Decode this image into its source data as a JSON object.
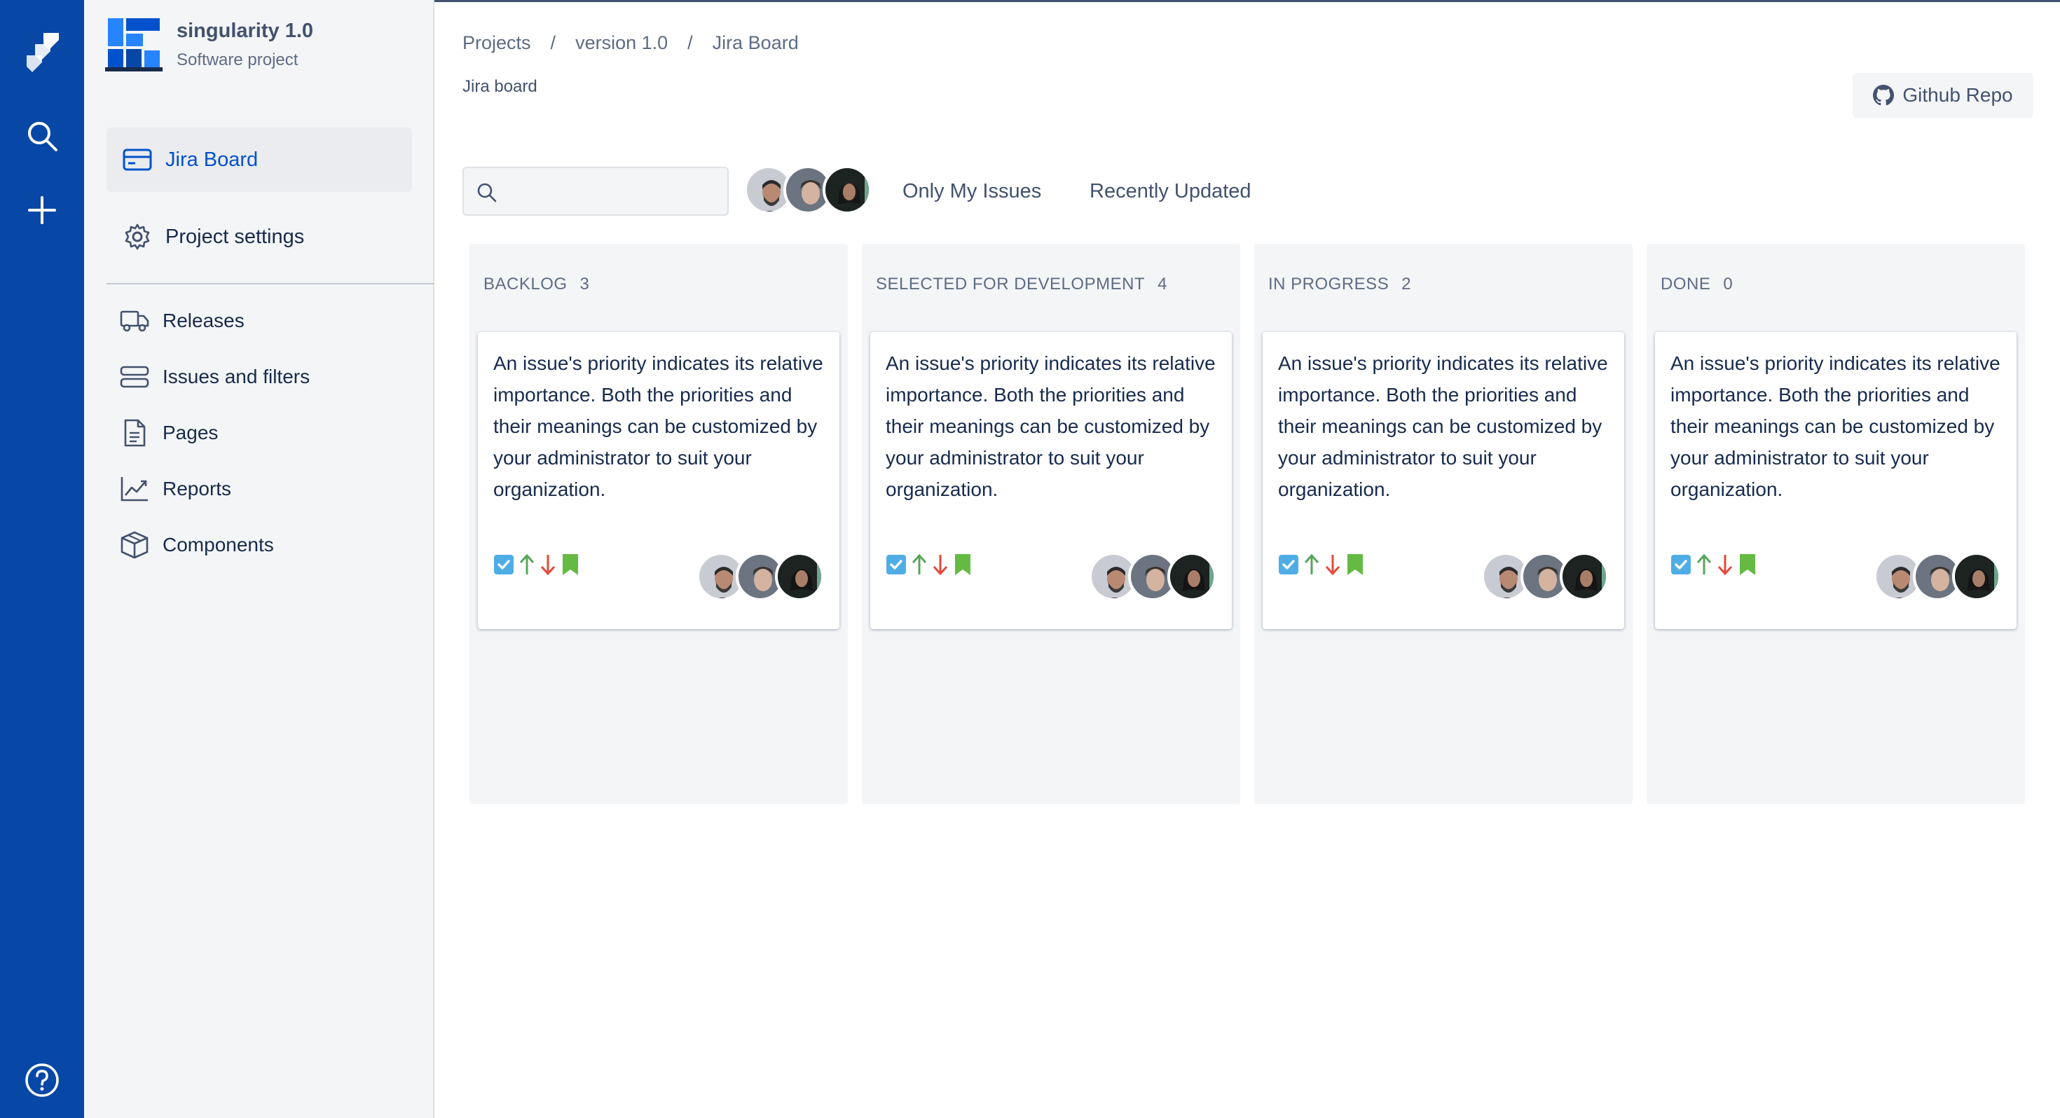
{
  "colors": {
    "nav": "#0747a6",
    "sidebar": "#f4f5f7",
    "accent": "#0052cc",
    "text": "#172b4d",
    "muted": "#5e6c84",
    "task": "#4fade6",
    "priority_high": "#57a55a",
    "priority_low": "#e5493a",
    "story": "#65ba43"
  },
  "navbar": {
    "icons": [
      "jira-logo-icon",
      "search-icon",
      "plus-icon",
      "help-icon"
    ]
  },
  "project": {
    "name": "singularity 1.0",
    "type": "Software project"
  },
  "sidebar": {
    "primary": [
      {
        "label": "Jira Board",
        "icon": "board-icon"
      },
      {
        "label": "Project settings",
        "icon": "gear-icon"
      }
    ],
    "secondary": [
      {
        "label": "Releases",
        "icon": "truck-icon"
      },
      {
        "label": "Issues and filters",
        "icon": "filter-icon"
      },
      {
        "label": "Pages",
        "icon": "page-icon"
      },
      {
        "label": "Reports",
        "icon": "chart-icon"
      },
      {
        "label": "Components",
        "icon": "box-icon"
      }
    ]
  },
  "breadcrumb": {
    "items": [
      "Projects",
      "version 1.0",
      "Jira Board"
    ],
    "separator": "/"
  },
  "page_title": "Jira board",
  "github_button": "Github Repo",
  "search": {
    "placeholder": "",
    "value": ""
  },
  "filters": {
    "only_my_issues": "Only My Issues",
    "recently_updated": "Recently Updated"
  },
  "columns": [
    {
      "title": "BACKLOG",
      "count": "3"
    },
    {
      "title": "SELECTED FOR DEVELOPMENT",
      "count": "4"
    },
    {
      "title": "IN PROGRESS",
      "count": "2"
    },
    {
      "title": "DONE",
      "count": "0"
    }
  ],
  "card_text": "An issue's priority indicates its relative importance. Both the priorities and their meanings can be customized by your administrator to suit your organization."
}
